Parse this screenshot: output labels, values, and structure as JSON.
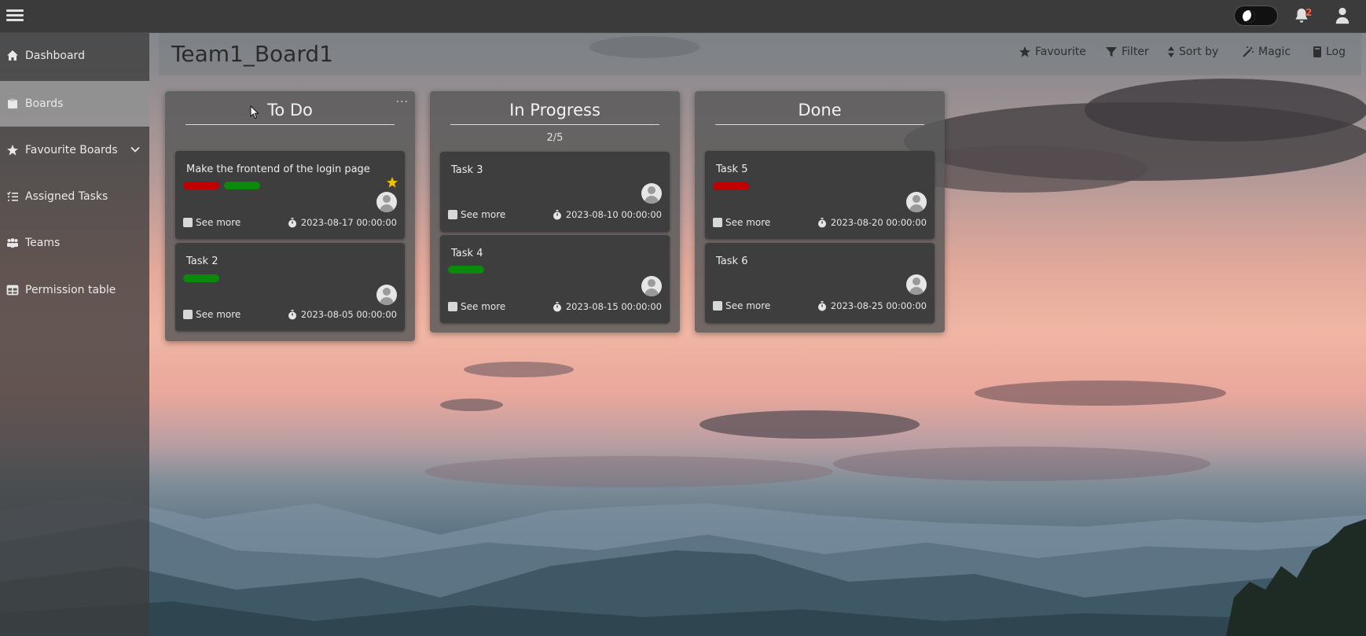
{
  "topbar": {
    "notification_count": "2"
  },
  "sidebar": {
    "items": [
      {
        "label": "Dashboard"
      },
      {
        "label": "Boards"
      },
      {
        "label": "Favourite Boards"
      },
      {
        "label": "Assigned Tasks"
      },
      {
        "label": "Teams"
      },
      {
        "label": "Permission table"
      }
    ],
    "active_item": "Boards"
  },
  "board": {
    "title": "Team1_Board1",
    "actions": [
      {
        "label": "Favourite"
      },
      {
        "label": "Filter"
      },
      {
        "label": "Sort by"
      },
      {
        "label": "Magic"
      },
      {
        "label": "Log"
      }
    ]
  },
  "columns": [
    {
      "title": "To Do",
      "menu": "···",
      "count": "",
      "cards": [
        {
          "title": "Make the frontend of the login page",
          "tags": [
            "red",
            "green"
          ],
          "favourite": true,
          "see_more": "See more",
          "due": "2023-08-17 00:00:00"
        },
        {
          "title": "Task 2",
          "tags": [
            "green"
          ],
          "favourite": false,
          "see_more": "See more",
          "due": "2023-08-05 00:00:00"
        }
      ]
    },
    {
      "title": "In Progress",
      "count": "2/5",
      "cards": [
        {
          "title": "Task 3",
          "tags": [],
          "favourite": false,
          "see_more": "See more",
          "due": "2023-08-10 00:00:00"
        },
        {
          "title": "Task 4",
          "tags": [
            "green"
          ],
          "favourite": false,
          "see_more": "See more",
          "due": "2023-08-15 00:00:00"
        }
      ]
    },
    {
      "title": "Done",
      "count": "",
      "cards": [
        {
          "title": "Task 5",
          "tags": [
            "red"
          ],
          "favourite": false,
          "see_more": "See more",
          "due": "2023-08-20 00:00:00"
        },
        {
          "title": "Task 6",
          "tags": [],
          "favourite": false,
          "see_more": "See more",
          "due": "2023-08-25 00:00:00"
        }
      ]
    }
  ],
  "colors": {
    "tag_red": "#c00000",
    "tag_green": "#0a8a0a",
    "star": "#f2c200",
    "notification_badge": "#ff5a36"
  },
  "icons": {
    "menu": "hamburger-icon",
    "theme": "moon-icon",
    "notifications": "bell-icon",
    "user": "user-icon"
  }
}
